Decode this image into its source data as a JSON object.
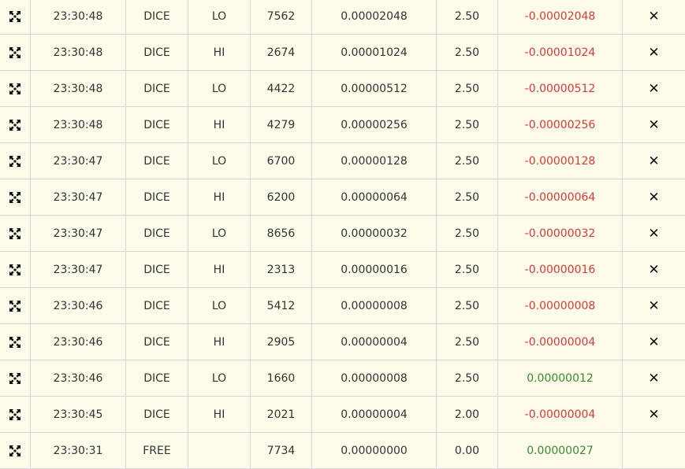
{
  "colors": {
    "background": "#fdfbea",
    "border": "#d8d8d8",
    "negative": "#d43a3a",
    "positive": "#3a8a2e"
  },
  "rows": [
    {
      "time": "23:30:48",
      "game": "DICE",
      "target": "LO",
      "roll": "7562",
      "bet": "0.00002048",
      "payout": "2.50",
      "profit": "-0.00002048",
      "status": "negative",
      "action": "✕"
    },
    {
      "time": "23:30:48",
      "game": "DICE",
      "target": "HI",
      "roll": "2674",
      "bet": "0.00001024",
      "payout": "2.50",
      "profit": "-0.00001024",
      "status": "negative",
      "action": "✕"
    },
    {
      "time": "23:30:48",
      "game": "DICE",
      "target": "LO",
      "roll": "4422",
      "bet": "0.00000512",
      "payout": "2.50",
      "profit": "-0.00000512",
      "status": "negative",
      "action": "✕"
    },
    {
      "time": "23:30:48",
      "game": "DICE",
      "target": "HI",
      "roll": "4279",
      "bet": "0.00000256",
      "payout": "2.50",
      "profit": "-0.00000256",
      "status": "negative",
      "action": "✕"
    },
    {
      "time": "23:30:47",
      "game": "DICE",
      "target": "LO",
      "roll": "6700",
      "bet": "0.00000128",
      "payout": "2.50",
      "profit": "-0.00000128",
      "status": "negative",
      "action": "✕"
    },
    {
      "time": "23:30:47",
      "game": "DICE",
      "target": "HI",
      "roll": "6200",
      "bet": "0.00000064",
      "payout": "2.50",
      "profit": "-0.00000064",
      "status": "negative",
      "action": "✕"
    },
    {
      "time": "23:30:47",
      "game": "DICE",
      "target": "LO",
      "roll": "8656",
      "bet": "0.00000032",
      "payout": "2.50",
      "profit": "-0.00000032",
      "status": "negative",
      "action": "✕"
    },
    {
      "time": "23:30:47",
      "game": "DICE",
      "target": "HI",
      "roll": "2313",
      "bet": "0.00000016",
      "payout": "2.50",
      "profit": "-0.00000016",
      "status": "negative",
      "action": "✕"
    },
    {
      "time": "23:30:46",
      "game": "DICE",
      "target": "LO",
      "roll": "5412",
      "bet": "0.00000008",
      "payout": "2.50",
      "profit": "-0.00000008",
      "status": "negative",
      "action": "✕"
    },
    {
      "time": "23:30:46",
      "game": "DICE",
      "target": "HI",
      "roll": "2905",
      "bet": "0.00000004",
      "payout": "2.50",
      "profit": "-0.00000004",
      "status": "negative",
      "action": "✕"
    },
    {
      "time": "23:30:46",
      "game": "DICE",
      "target": "LO",
      "roll": "1660",
      "bet": "0.00000008",
      "payout": "2.50",
      "profit": "0.00000012",
      "status": "positive",
      "action": "✕"
    },
    {
      "time": "23:30:45",
      "game": "DICE",
      "target": "HI",
      "roll": "2021",
      "bet": "0.00000004",
      "payout": "2.00",
      "profit": "-0.00000004",
      "status": "negative",
      "action": "✕"
    },
    {
      "time": "23:30:31",
      "game": "FREE",
      "target": "",
      "roll": "7734",
      "bet": "0.00000000",
      "payout": "0.00",
      "profit": "0.00000027",
      "status": "positive",
      "action": ""
    }
  ]
}
